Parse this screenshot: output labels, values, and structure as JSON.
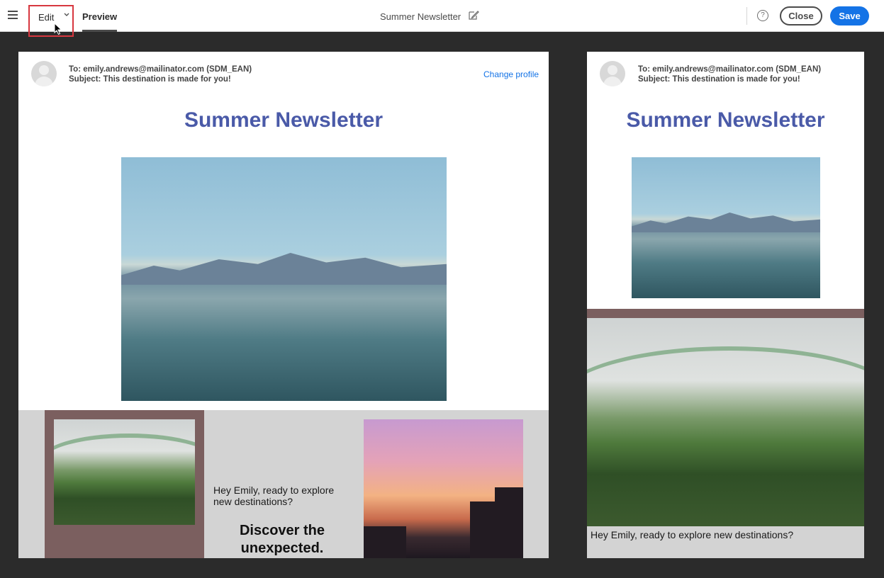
{
  "topbar": {
    "edit_label": "Edit",
    "preview_label": "Preview",
    "document_title": "Summer Newsletter",
    "help_glyph": "?",
    "close_label": "Close",
    "save_label": "Save",
    "accent_color": "#1473e6",
    "highlight_color": "#d7373f"
  },
  "email": {
    "to": "To: emily.andrews@mailinator.com (SDM_EAN)",
    "subject": "Subject: This destination is made for you!",
    "change_profile": "Change profile",
    "title": "Summer Newsletter",
    "greeting": "Hey Emily, ready to explore new destinations?",
    "cta_line1": "Discover the",
    "cta_line2": "unexpected.",
    "title_color": "#4a5aa8"
  },
  "mobile": {
    "to": "To: emily.andrews@mailinator.com (SDM_EAN)",
    "subject": "Subject: This destination is made for you!",
    "title": "Summer Newsletter",
    "greeting": "Hey Emily, ready to explore new destinations?"
  },
  "icons": [
    "menu-icon",
    "chevron-down-icon",
    "cursor-icon",
    "pencil-icon",
    "help-icon",
    "avatar-icon"
  ]
}
